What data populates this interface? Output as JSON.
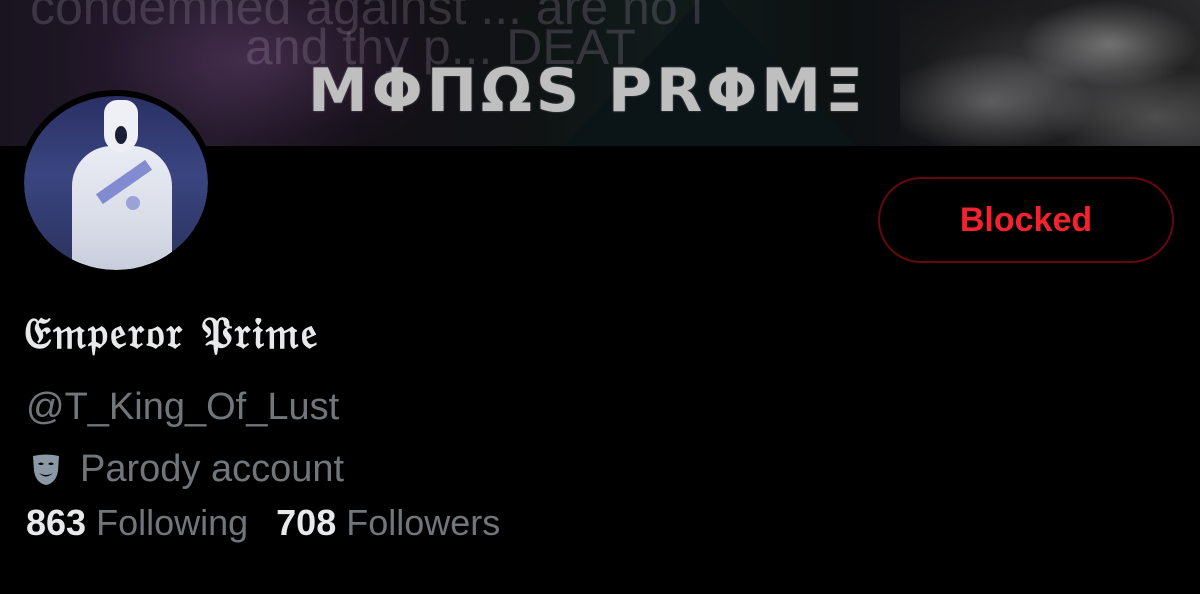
{
  "banner": {
    "title": "ΜΦΠΩS PRΦΜΞ",
    "ghost_line_1": "condemned against ... are no l",
    "ghost_line_2": "and thy p... DEAT"
  },
  "profile": {
    "display_name": "𝔈𝔪𝔭𝔢𝔯𝔬𝔯 𝔓𝔯𝔦𝔪𝔢",
    "handle": "@T_King_Of_Lust",
    "label": "Parody account",
    "label_icon": "theater-mask-icon"
  },
  "actions": {
    "blocked_label": "Blocked",
    "blocked_color": "#f4212e",
    "blocked_border_color": "#67070f"
  },
  "stats": {
    "following_count": "863",
    "following_label": "Following",
    "followers_count": "708",
    "followers_label": "Followers"
  },
  "colors": {
    "background": "#000000",
    "primary_text": "#e7e9ea",
    "secondary_text": "#71767b"
  }
}
